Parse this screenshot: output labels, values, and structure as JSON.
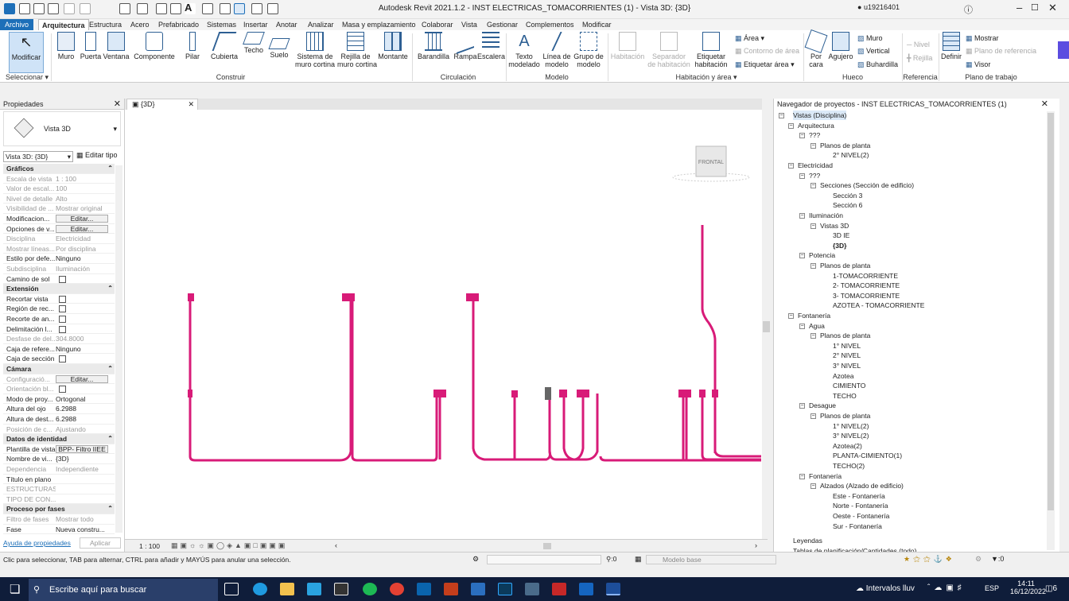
{
  "window": {
    "title": "Autodesk Revit 2021.1.2 - INST ELECTRICAS_TOMACORRIENTES (1) - Vista 3D: {3D}",
    "user": "u19216401"
  },
  "ribbon_tabs": [
    "Archivo",
    "Arquitectura",
    "Estructura",
    "Acero",
    "Prefabricado",
    "Sistemas",
    "Insertar",
    "Anotar",
    "Analizar",
    "Masa y emplazamiento",
    "Colaborar",
    "Vista",
    "Gestionar",
    "Complementos",
    "Modificar"
  ],
  "ribbon": {
    "modify": "Modificar",
    "select": "Seleccionar",
    "build": [
      "Muro",
      "Puerta",
      "Ventana",
      "Componente",
      "Pilar",
      "Cubierta",
      "Techo",
      "Suelo",
      "Sistema de\nmuro cortina",
      "Rejilla de\nmuro cortina",
      "Montante"
    ],
    "circulation": [
      "Barandilla",
      "Rampa",
      "Escalera"
    ],
    "model": [
      "Texto\nmodelado",
      "Línea de\nmodelo",
      "Grupo de\nmodelo"
    ],
    "room": [
      "Habitación",
      "Separador\nde habitación",
      "Etiquetar\nhabitación"
    ],
    "room_small": [
      "Área",
      "Contorno de área",
      "Etiquetar  área"
    ],
    "opening": [
      "Por\ncara",
      "Agujero"
    ],
    "opening_small": [
      "Muro",
      "Vertical",
      "Buhardilla"
    ],
    "datum": [
      "Nivel",
      "Rejilla"
    ],
    "workplane_btn": "Definir",
    "workplane_small": [
      "Mostrar",
      "Plano de referencia",
      "Visor"
    ],
    "groups": [
      "Construir",
      "Circulación",
      "Modelo",
      "Habitación y área",
      "Hueco",
      "Referencia",
      "Plano de trabajo"
    ]
  },
  "properties": {
    "title": "Propiedades",
    "type_name": "Vista 3D",
    "selector": "Vista 3D: {3D}",
    "edit_type": "Editar tipo",
    "help": "Ayuda de propiedades",
    "apply": "Aplicar",
    "rows": [
      {
        "s": 1,
        "k": "Gráficos"
      },
      {
        "k": "Escala de vista",
        "v": "1 : 100",
        "d": 1
      },
      {
        "k": "Valor de escal...",
        "v": "100",
        "d": 1
      },
      {
        "k": "Nivel de detalle",
        "v": "Alto",
        "d": 1
      },
      {
        "k": "Visibilidad de ...",
        "v": "Mostrar original",
        "d": 1
      },
      {
        "k": "Modificacion...",
        "v": "Editar...",
        "b": 1
      },
      {
        "k": "Opciones de v...",
        "v": "Editar...",
        "b": 1
      },
      {
        "k": "Disciplina",
        "v": "Electricidad",
        "d": 1
      },
      {
        "k": "Mostrar líneas...",
        "v": "Por disciplina",
        "d": 1
      },
      {
        "k": "Estilo por defe...",
        "v": "Ninguno"
      },
      {
        "k": "Subdisciplina",
        "v": "Iluminación",
        "d": 1
      },
      {
        "k": "Camino de sol",
        "c": 1
      },
      {
        "s": 1,
        "k": "Extensión"
      },
      {
        "k": "Recortar vista",
        "c": 1
      },
      {
        "k": "Región de rec...",
        "c": 1
      },
      {
        "k": "Recorte de an...",
        "c": 1
      },
      {
        "k": "Delimitación l...",
        "c": 1
      },
      {
        "k": "Desfase de del...",
        "v": "304.8000",
        "d": 1
      },
      {
        "k": "Caja de refere...",
        "v": "Ninguno"
      },
      {
        "k": "Caja de sección",
        "c": 1
      },
      {
        "s": 1,
        "k": "Cámara"
      },
      {
        "k": "Configuració...",
        "v": "Editar...",
        "b": 1,
        "d": 1
      },
      {
        "k": "Orientación bl...",
        "c": 1,
        "d": 1
      },
      {
        "k": "Modo de proy...",
        "v": "Ortogonal"
      },
      {
        "k": "Altura del ojo",
        "v": "6.2988"
      },
      {
        "k": "Altura de dest...",
        "v": "6.2988"
      },
      {
        "k": "Posición de c...",
        "v": "Ajustando",
        "d": 1
      },
      {
        "s": 1,
        "k": "Datos de identidad"
      },
      {
        "k": "Plantilla de vista",
        "v": "BPP- Filtro IIEE",
        "b": 1
      },
      {
        "k": "Nombre de vi...",
        "v": "{3D}"
      },
      {
        "k": "Dependencia",
        "v": "Independiente",
        "d": 1
      },
      {
        "k": "Título en plano",
        "v": ""
      },
      {
        "k": "ESTRUCTURAS",
        "v": "",
        "d": 1
      },
      {
        "k": "TIPO DE CON...",
        "v": "",
        "d": 1
      },
      {
        "s": 1,
        "k": "Proceso por fases"
      },
      {
        "k": "Filtro de fases",
        "v": "Mostrar todo",
        "d": 1
      },
      {
        "k": "Fase",
        "v": "Nueva constru..."
      }
    ]
  },
  "view": {
    "tab": "{3D}",
    "viewcube": "FRONTAL",
    "scale": "1 : 100"
  },
  "browser": {
    "title": "Navegador de proyectos - INST ELECTRICAS_TOMACORRIENTES (1)",
    "nodes": [
      {
        "l": 0,
        "t": "Vistas (Disciplina)",
        "x": 1
      },
      {
        "l": 1,
        "t": "Arquitectura",
        "x": 1
      },
      {
        "l": 2,
        "t": "???",
        "x": 1
      },
      {
        "l": 3,
        "t": "Planos de planta",
        "x": 1
      },
      {
        "l": 4,
        "t": "2° NIVEL(2)"
      },
      {
        "l": 1,
        "t": "Electricidad",
        "x": 1
      },
      {
        "l": 2,
        "t": "???",
        "x": 1
      },
      {
        "l": 3,
        "t": "Secciones (Sección de edificio)",
        "x": 1
      },
      {
        "l": 4,
        "t": "Sección 3"
      },
      {
        "l": 4,
        "t": "Sección 6"
      },
      {
        "l": 2,
        "t": "Iluminación",
        "x": 1
      },
      {
        "l": 3,
        "t": "Vistas 3D",
        "x": 1
      },
      {
        "l": 4,
        "t": "3D IE"
      },
      {
        "l": 4,
        "t": "{3D}",
        "bold": 1
      },
      {
        "l": 2,
        "t": "Potencia",
        "x": 1
      },
      {
        "l": 3,
        "t": "Planos de planta",
        "x": 1
      },
      {
        "l": 4,
        "t": "1-TOMACORRIENTE"
      },
      {
        "l": 4,
        "t": "2- TOMACORRIENTE"
      },
      {
        "l": 4,
        "t": "3- TOMACORRIENTE"
      },
      {
        "l": 4,
        "t": "AZOTEA - TOMACORRIENTE"
      },
      {
        "l": 1,
        "t": "Fontanería",
        "x": 1
      },
      {
        "l": 2,
        "t": "Agua",
        "x": 1
      },
      {
        "l": 3,
        "t": "Planos de planta",
        "x": 1
      },
      {
        "l": 4,
        "t": "1° NIVEL"
      },
      {
        "l": 4,
        "t": "2° NIVEL"
      },
      {
        "l": 4,
        "t": "3° NIVEL"
      },
      {
        "l": 4,
        "t": "Azotea"
      },
      {
        "l": 4,
        "t": "CIMIENTO"
      },
      {
        "l": 4,
        "t": "TECHO"
      },
      {
        "l": 2,
        "t": "Desague",
        "x": 1
      },
      {
        "l": 3,
        "t": "Planos de planta",
        "x": 1
      },
      {
        "l": 4,
        "t": "1° NIVEL(2)"
      },
      {
        "l": 4,
        "t": "3° NIVEL(2)"
      },
      {
        "l": 4,
        "t": "Azotea(2)"
      },
      {
        "l": 4,
        "t": "PLANTA-CIMIENTO(1)"
      },
      {
        "l": 4,
        "t": "TECHO(2)"
      },
      {
        "l": 2,
        "t": "Fontanería",
        "x": 1
      },
      {
        "l": 3,
        "t": "Alzados (Alzado de edificio)",
        "x": 1
      },
      {
        "l": 4,
        "t": "Este - Fontanería"
      },
      {
        "l": 4,
        "t": "Norte - Fontanería"
      },
      {
        "l": 4,
        "t": "Oeste - Fontanería"
      },
      {
        "l": 4,
        "t": "Sur - Fontanería"
      },
      {
        "l": 0,
        "t": "Leyendas"
      },
      {
        "l": 0,
        "t": "Tablas de planificación/Cantidades (todo)"
      }
    ]
  },
  "status": {
    "hint": "Clic para seleccionar, TAB para alternar, CTRL para añadir y MAYÚS para anular una selección.",
    "sel_count": ":0",
    "model": "Modelo base",
    "filter": ":0"
  },
  "taskbar": {
    "search": "Escribe aquí para buscar",
    "weather": "Intervalos lluv",
    "lang": "ESP",
    "time": "14:11",
    "date": "16/12/2022",
    "notif": "6"
  },
  "colors": {
    "conduit": "#d81b78",
    "accent": "#1d6fb8"
  }
}
